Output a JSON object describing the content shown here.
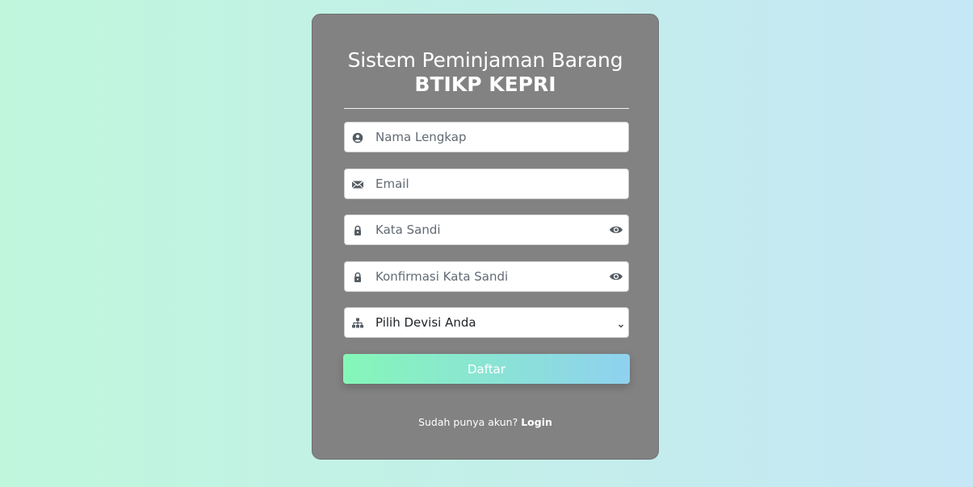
{
  "header": {
    "title_line1": "Sistem Peminjaman Barang",
    "title_line2": "BTIKP KEPRI"
  },
  "form": {
    "name": {
      "placeholder": "Nama Lengkap",
      "value": "",
      "icon": "user-circle-icon"
    },
    "email": {
      "placeholder": "Email",
      "value": "",
      "icon": "envelope-icon"
    },
    "password": {
      "placeholder": "Kata Sandi",
      "value": "",
      "icon": "lock-icon",
      "toggle_icon": "eye-icon"
    },
    "confirm_password": {
      "placeholder": "Konfirmasi Kata Sandi",
      "value": "",
      "icon": "lock-icon",
      "toggle_icon": "eye-icon"
    },
    "division": {
      "selected": "Pilih Devisi Anda",
      "icon": "sitemap-icon"
    },
    "submit_label": "Daftar"
  },
  "footer": {
    "prompt": "Sudah punya akun?",
    "login_label": "Login"
  },
  "colors": {
    "card": "#828282",
    "button_gradient_start": "#85f7b8",
    "button_gradient_end": "#8fd1ef",
    "background_start": "#c0f7dc",
    "background_end": "#c6e7f6"
  }
}
